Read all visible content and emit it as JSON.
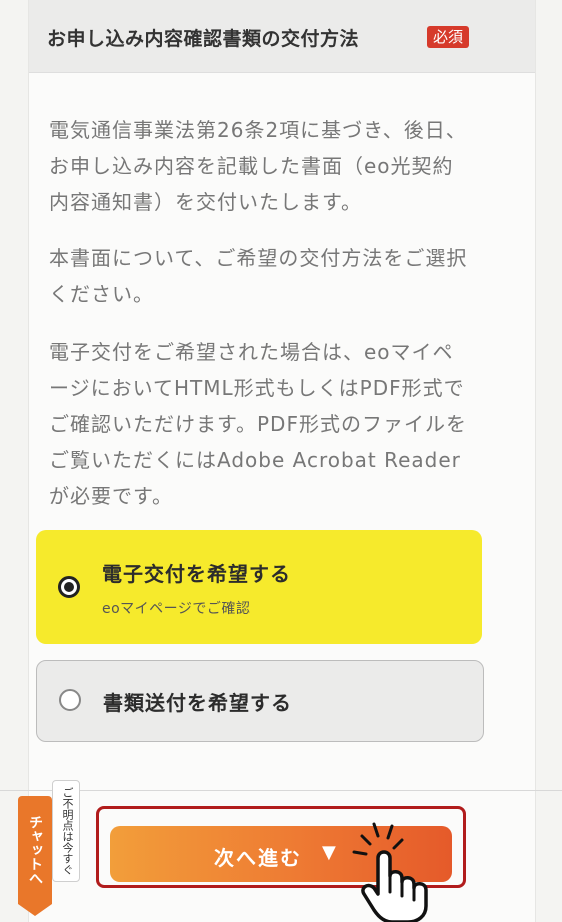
{
  "section": {
    "title": "お申し込み内容確認書類の交付方法",
    "required_badge": "必須"
  },
  "paragraphs": [
    [
      "電気通信事業法第26条2項に基づき、後日、",
      "お申し込み内容を記載した書面（eo光契約",
      "内容通知書）を交付いたします。"
    ],
    [
      "本書面について、ご希望の交付方法をご選択",
      "ください。"
    ],
    [
      "電子交付をご希望された場合は、eoマイペ",
      "ージにおいてHTML形式もしくはPDF形式で",
      "ご確認いただけます。PDF形式のファイルを",
      "ご覧いただくにはAdobe Acrobat Reader",
      "が必要です。"
    ]
  ],
  "options": [
    {
      "label": "電子交付を希望する",
      "sublabel": "eoマイページでご確認",
      "selected": true
    },
    {
      "label": "書類送付を希望する",
      "sublabel": "",
      "selected": false
    }
  ],
  "chat": {
    "tab_label": "チャットへ",
    "note": "ご不明点は今すぐ"
  },
  "next_button": {
    "label": "次へ進む",
    "arrow": "▼"
  },
  "colors": {
    "selected_option": "#f6ea2c",
    "badge": "#d63a2b",
    "button_start": "#f29e3a",
    "button_end": "#e55a2a",
    "highlight": "#b11c1c"
  }
}
